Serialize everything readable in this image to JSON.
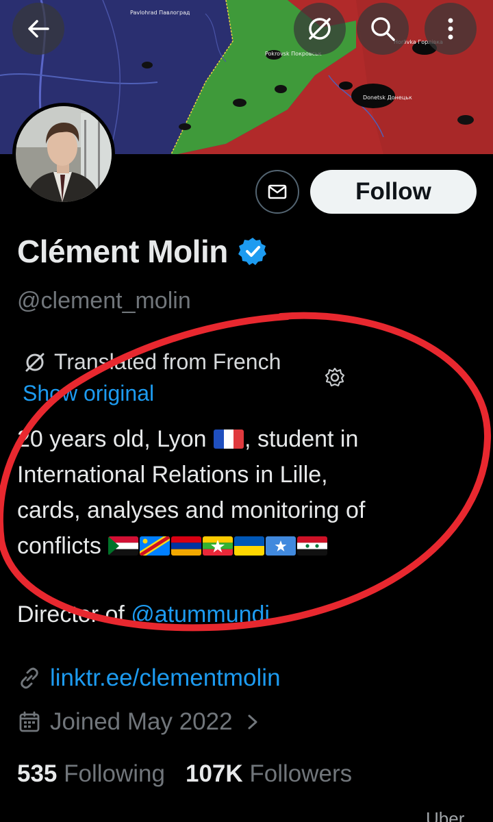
{
  "banner": {
    "map_labels": {
      "pavlohrad": "Pavlohrad Павлоград",
      "horlivka": "Horlivka Горлівка",
      "pokrovsk": "Pokrovsk Покровськ",
      "donetsk": "Donetsk Донецьк"
    }
  },
  "top_bar": {
    "back_icon": "arrow-left-icon",
    "translate_icon": "translate-off-icon",
    "search_icon": "search-icon",
    "more_icon": "more-vertical-icon"
  },
  "profile": {
    "name": "Clément Molin",
    "handle": "@clement_molin",
    "follow_label": "Follow",
    "translation_notice": "Translated from French",
    "show_original_label": "Show original",
    "bio_lines": [
      "20 years old, Lyon",
      ", student in",
      "International Relations in Lille,",
      "cards, analyses and monitoring of",
      "conflicts"
    ],
    "director_prefix": "Director of ",
    "director_mention": "@atummundi",
    "website": "linktr.ee/clementmolin",
    "joined": "Joined May 2022",
    "following_count": "535",
    "following_label": "Following",
    "followers_count": "107K",
    "followers_label": "Followers"
  },
  "footer": {
    "corner_text": "Uber"
  },
  "colors": {
    "accent": "#1d9bf0",
    "background": "#000000",
    "text_primary": "#e7e9ea",
    "text_secondary": "#71767b",
    "annotation": "#e8282f"
  }
}
